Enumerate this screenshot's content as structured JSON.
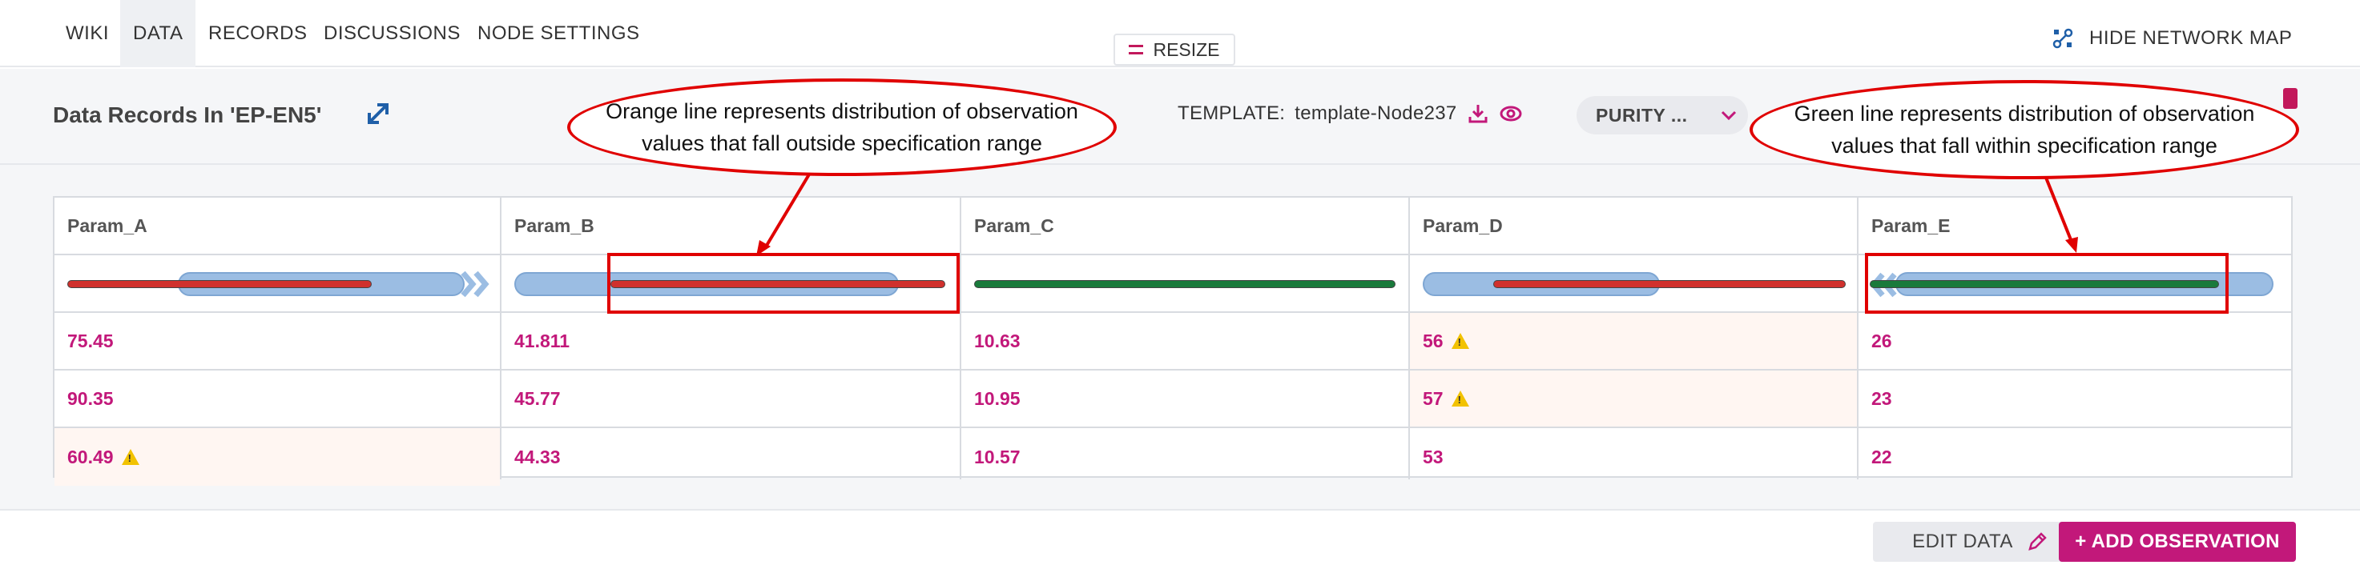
{
  "nav": {
    "tabs": [
      {
        "label": "WIKI"
      },
      {
        "label": "DATA"
      },
      {
        "label": "RECORDS"
      },
      {
        "label": "DISCUSSIONS"
      },
      {
        "label": "NODE SETTINGS"
      }
    ],
    "active_tab": "DATA",
    "resize_label": "RESIZE",
    "hide_map_label": "HIDE NETWORK MAP"
  },
  "header": {
    "title": "Data Records In 'EP-EN5'",
    "template_label": "TEMPLATE:",
    "template_value": "template-Node237",
    "purity_label": "PURITY ..."
  },
  "table": {
    "columns": [
      {
        "name": "Param_A"
      },
      {
        "name": "Param_B"
      },
      {
        "name": "Param_C"
      },
      {
        "name": "Param_D"
      },
      {
        "name": "Param_E"
      }
    ],
    "rows": [
      {
        "cells": [
          {
            "value": "75.45",
            "warning": false
          },
          {
            "value": "41.811",
            "warning": false
          },
          {
            "value": "10.63",
            "warning": false
          },
          {
            "value": "56",
            "warning": true
          },
          {
            "value": "26",
            "warning": false
          }
        ]
      },
      {
        "cells": [
          {
            "value": "90.35",
            "warning": false
          },
          {
            "value": "45.77",
            "warning": false
          },
          {
            "value": "10.95",
            "warning": false
          },
          {
            "value": "57",
            "warning": true
          },
          {
            "value": "23",
            "warning": false
          }
        ]
      },
      {
        "cells": [
          {
            "value": "60.49",
            "warning": true
          },
          {
            "value": "44.33",
            "warning": false
          },
          {
            "value": "10.57",
            "warning": false
          },
          {
            "value": "53",
            "warning": false
          },
          {
            "value": "22",
            "warning": false
          }
        ]
      }
    ]
  },
  "footer": {
    "edit_label": "EDIT DATA",
    "add_label": "+ ADD OBSERVATION"
  },
  "annotations": {
    "orange_note": "Orange line represents distribution of observation values that fall outside specification range",
    "green_note": "Green line represents distribution of observation values that fall within specification range"
  },
  "colors": {
    "accent": "#c2187a",
    "value_text": "#c2187a",
    "range_blue": "#9bbde3",
    "out_of_spec_line": "#d0312d",
    "in_spec_line": "#1a7a3b",
    "annotation_red": "#e00000",
    "warning_yellow": "#f2c200"
  },
  "icons": [
    "expand-icon",
    "download-icon",
    "eye-icon",
    "chevron-down-icon",
    "network-map-icon",
    "pencil-icon",
    "warning-icon",
    "resize-icon"
  ]
}
